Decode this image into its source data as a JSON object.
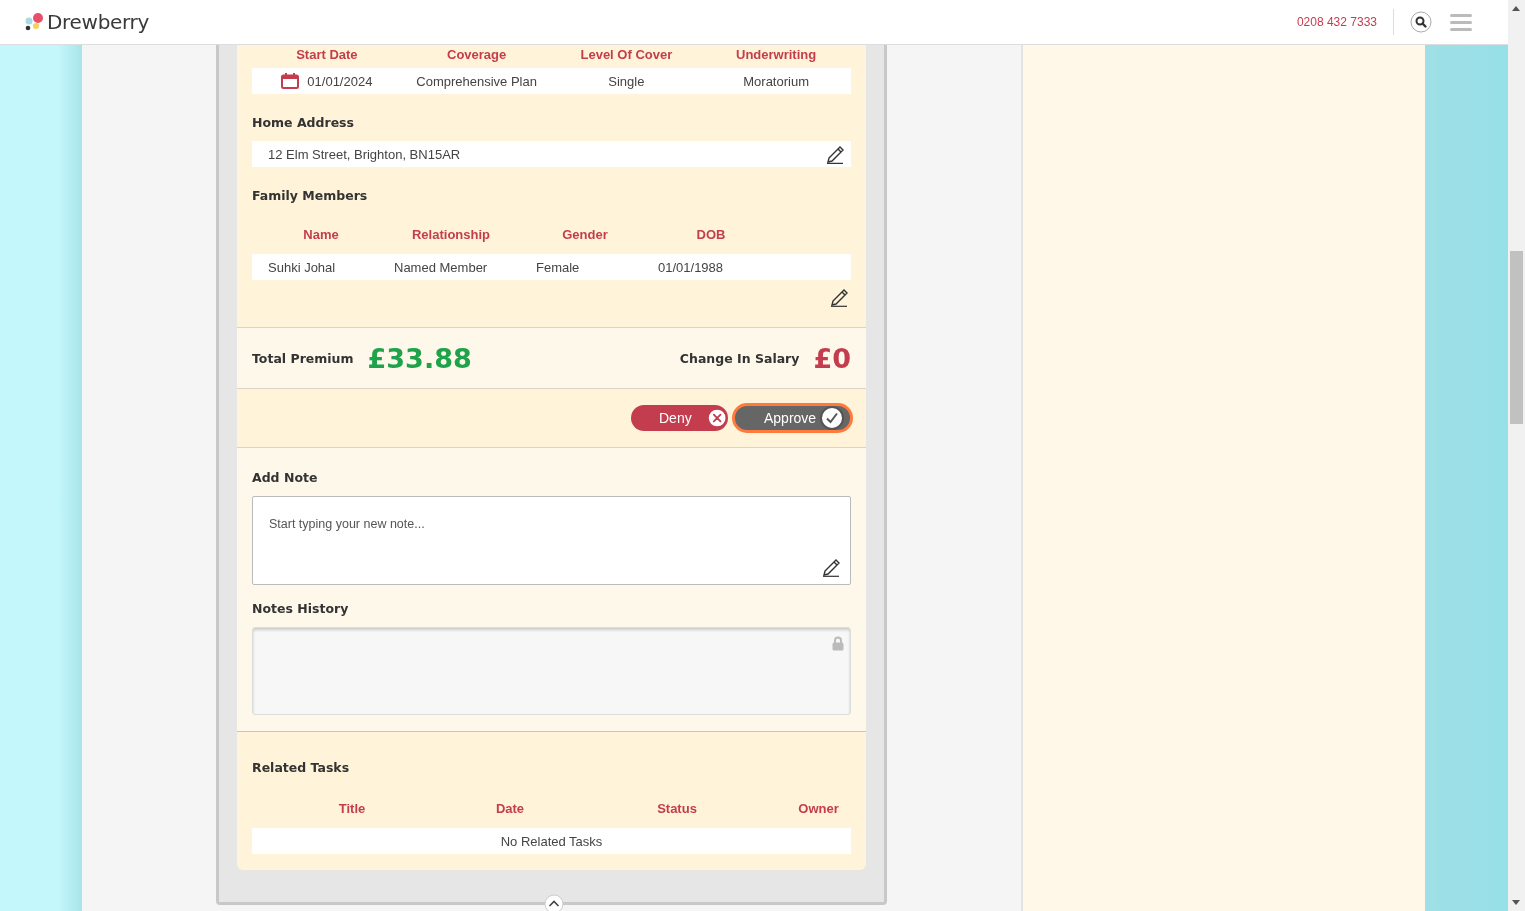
{
  "header": {
    "brand": "Drewberry",
    "phone": "0208 432 7333"
  },
  "policy": {
    "columns": [
      "Start Date",
      "Coverage",
      "Level Of Cover",
      "Underwriting"
    ],
    "row": [
      "01/01/2024",
      "Comprehensive Plan",
      "Single",
      "Moratorium"
    ]
  },
  "home_address": {
    "label": "Home Address",
    "value": "12 Elm Street, Brighton, BN15AR"
  },
  "family": {
    "label": "Family Members",
    "columns": [
      "Name",
      "Relationship",
      "Gender",
      "DOB"
    ],
    "rows": [
      [
        "Suhki Johal",
        "Named Member",
        "Female",
        "01/01/1988"
      ]
    ]
  },
  "premium": {
    "label": "Total Premium",
    "amount": "£33.88"
  },
  "salary_change": {
    "label": "Change In Salary",
    "amount": "£0"
  },
  "actions": [
    {
      "label": "Deny",
      "kind": "deny",
      "focused": false
    },
    {
      "label": "Approve",
      "kind": "approve",
      "focused": true
    }
  ],
  "note": {
    "label": "Add Note",
    "placeholder": "Start typing your new note..."
  },
  "notes_history": {
    "label": "Notes History",
    "locked": true
  },
  "related_tasks": {
    "label": "Related Tasks",
    "columns": [
      "Title",
      "Date",
      "Status",
      "Owner"
    ],
    "empty_text": "No Related Tasks"
  }
}
